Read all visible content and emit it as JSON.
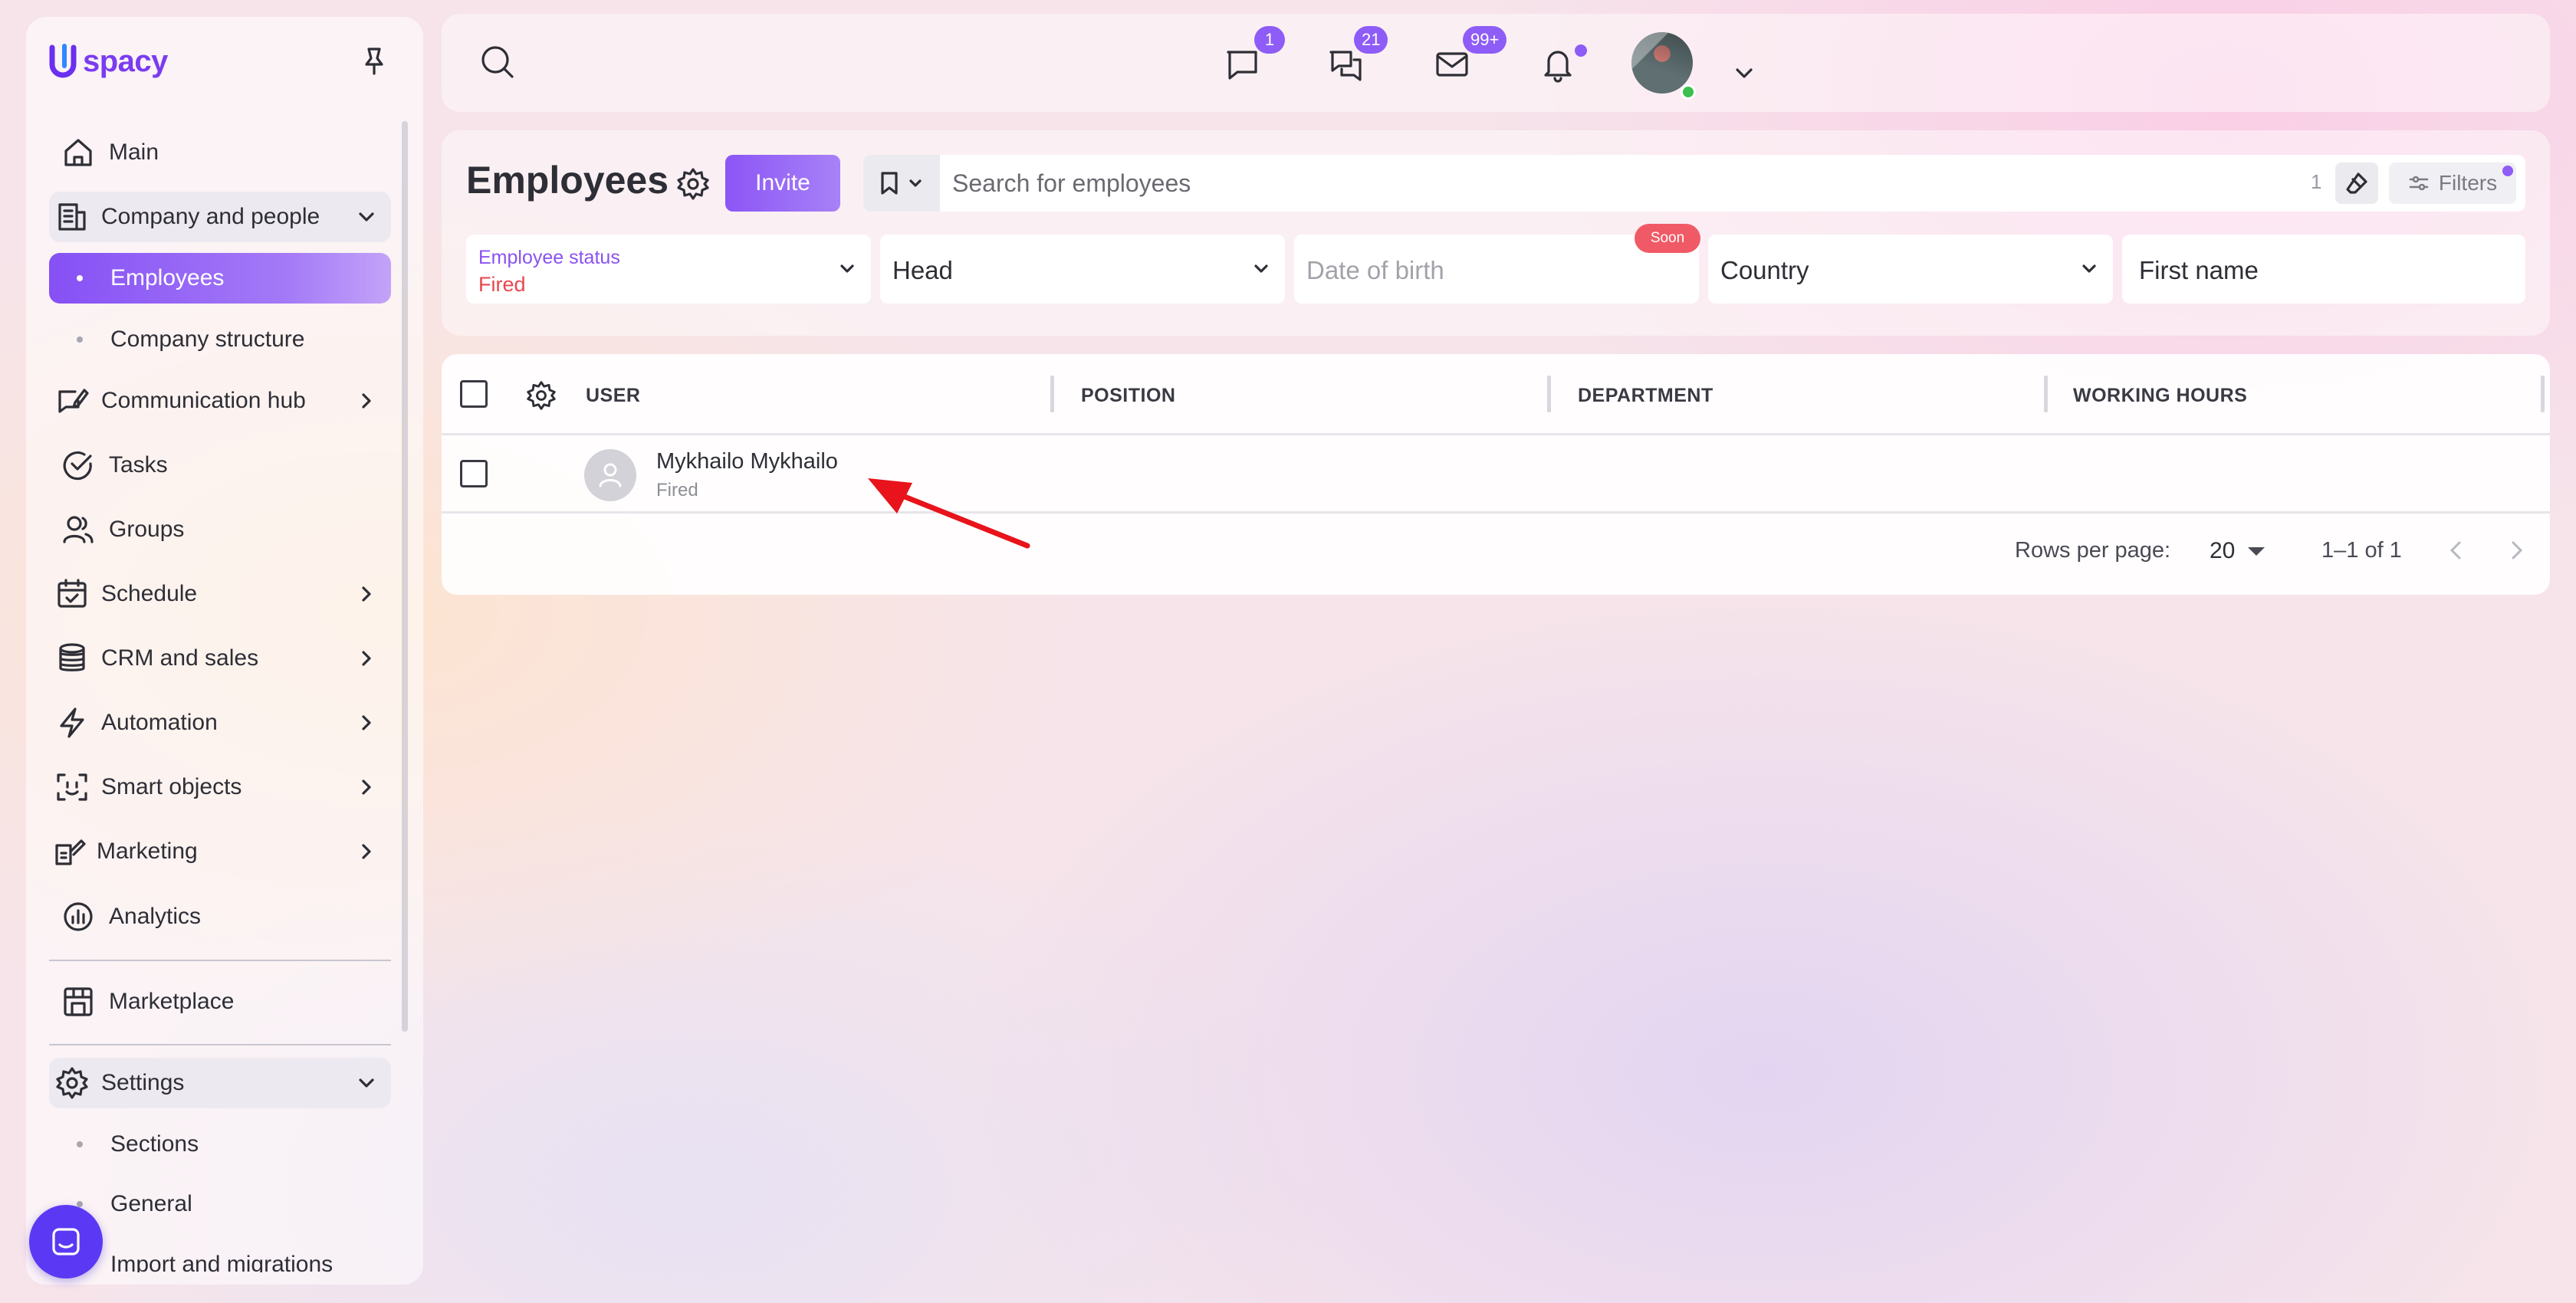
{
  "app": {
    "logo_text": "spacy",
    "brand_color": "#7a3cf0",
    "accent_color": "#8e5cf6"
  },
  "sidebar": {
    "items": [
      {
        "label": "Main",
        "icon": "home-icon"
      },
      {
        "label": "Company and people",
        "icon": "building-icon",
        "expanded": true
      },
      {
        "label": "Communication hub",
        "icon": "chat-pen-icon"
      },
      {
        "label": "Tasks",
        "icon": "check-circle-icon"
      },
      {
        "label": "Groups",
        "icon": "users-icon"
      },
      {
        "label": "Schedule",
        "icon": "calendar-icon"
      },
      {
        "label": "CRM and sales",
        "icon": "coins-icon"
      },
      {
        "label": "Automation",
        "icon": "lightning-icon"
      },
      {
        "label": "Smart objects",
        "icon": "scan-face-icon"
      },
      {
        "label": "Marketing",
        "icon": "megaphone-icon"
      },
      {
        "label": "Analytics",
        "icon": "chart-icon"
      },
      {
        "label": "Marketplace",
        "icon": "store-icon"
      },
      {
        "label": "Settings",
        "icon": "gear-icon",
        "expanded": true
      }
    ],
    "company_sub": [
      {
        "label": "Employees",
        "active": true
      },
      {
        "label": "Company structure"
      }
    ],
    "settings_sub": [
      {
        "label": "Sections"
      },
      {
        "label": "General"
      },
      {
        "label": "Import and migrations"
      }
    ]
  },
  "topbar": {
    "badges": {
      "messages": "1",
      "chats": "21",
      "mail": "99+"
    },
    "status_color": "#3bbf4f"
  },
  "employees": {
    "title": "Employees",
    "invite_label": "Invite",
    "search_placeholder": "Search for employees",
    "search_count": "1",
    "filters_label": "Filters",
    "filter_fields": {
      "status_label": "Employee status",
      "status_value": "Fired",
      "head": "Head",
      "date_of_birth": "Date of birth",
      "soon_badge": "Soon",
      "country": "Country",
      "first_name": "First name"
    }
  },
  "table": {
    "columns": [
      "USER",
      "POSITION",
      "DEPARTMENT",
      "WORKING HOURS"
    ],
    "rows": [
      {
        "name": "Mykhailo Mykhailo",
        "status": "Fired",
        "position": "",
        "department": "",
        "working_hours": ""
      }
    ],
    "pagination": {
      "rows_per_page_label": "Rows per page:",
      "rows_per_page": "20",
      "range": "1–1 of 1"
    }
  },
  "annotation": {
    "arrow_color": "#e8131b"
  }
}
